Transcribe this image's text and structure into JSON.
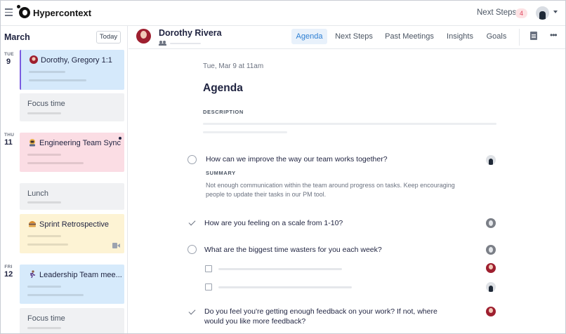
{
  "app": {
    "brand": "Hypercontext",
    "next_steps_label": "Next Steps",
    "next_steps_count": "4"
  },
  "sidebar": {
    "month": "March",
    "today_label": "Today",
    "days": [
      {
        "dow": "TUE",
        "num": "9"
      },
      {
        "dow": "THU",
        "num": "11"
      },
      {
        "dow": "FRI",
        "num": "12"
      }
    ],
    "events": [
      {
        "title": "Dorothy, Gregory 1:1",
        "color": "#d5e9fb",
        "icon": "avatar-icon"
      },
      {
        "title": "Focus time",
        "color": "#f0f1f3"
      },
      {
        "title": "Engineering Team Sync",
        "color": "#fbdde4",
        "icon": "astronaut-emoji-icon"
      },
      {
        "title": "Lunch",
        "color": "#f0f1f3"
      },
      {
        "title": "Sprint Retrospective",
        "color": "#fdf3d4",
        "icon": "burger-emoji-icon"
      },
      {
        "title": "Leadership Team mee...",
        "color": "#d6eafb",
        "icon": "runner-emoji-icon"
      },
      {
        "title": "Focus time",
        "color": "#f0f1f3"
      }
    ]
  },
  "header": {
    "person_name": "Dorothy Rivera",
    "tabs": [
      "Agenda",
      "Next Steps",
      "Past Meetings",
      "Insights",
      "Goals"
    ],
    "active_tab": "Agenda"
  },
  "agenda": {
    "date": "Tue, Mar 9 at 11am",
    "title": "Agenda",
    "description_label": "DESCRIPTION",
    "items": [
      {
        "question": "How can we improve the way our team works together?",
        "state": "open",
        "summary_label": "SUMMARY",
        "summary": "Not enough communication within the team around progress on tasks. Keep encouraging people to update their tasks in our PM tool."
      },
      {
        "question": "How are you feeling on a scale from 1-10?",
        "state": "done"
      },
      {
        "question": "What are the biggest time wasters for you each week?",
        "state": "open"
      },
      {
        "question": "Do you feel you're getting enough feedback on your work? If not, where would you like more feedback?",
        "state": "done"
      }
    ]
  },
  "colors": {
    "accent": "#2d7fd3",
    "active_tab_bg": "#e8f1fb",
    "badge_bg": "#fde2e4",
    "badge_text": "#e0415a"
  }
}
